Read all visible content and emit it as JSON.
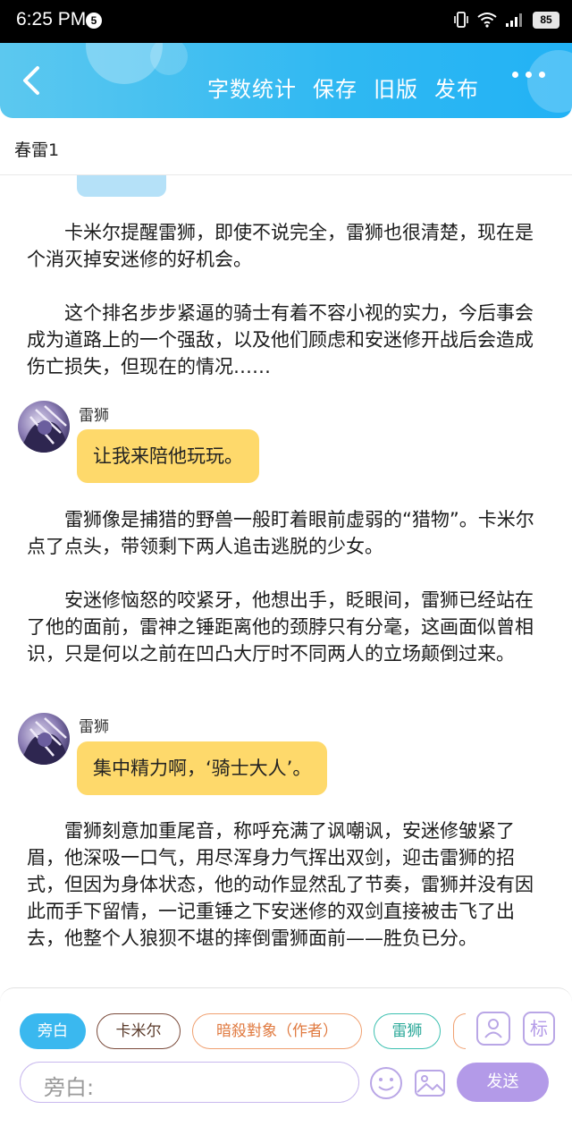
{
  "status_bar": {
    "time": "6:25 PM",
    "notification_badge": "5",
    "battery": "85"
  },
  "header": {
    "actions": [
      "字数统计",
      "保存",
      "旧版",
      "发布"
    ]
  },
  "chapter": {
    "title": "春雷1"
  },
  "content": {
    "paragraphs": [
      "卡米尔提醒雷狮，即使不说完全，雷狮也很清楚，现在是个消灭掉安迷修的好机会。",
      "这个排名步步紧逼的骑士有着不容小视的实力，今后事会成为道路上的一个强敌，以及他们顾虑和安迷修开战后会造成伤亡损失，但现在的情况……",
      "雷狮像是捕猎的野兽一般盯着眼前虚弱的“猎物”。卡米尔点了点头，带领剩下两人追击逃脱的少女。",
      "安迷修恼怒的咬紧牙，他想出手，眨眼间，雷狮已经站在了他的面前，雷神之锤距离他的颈脖只有分毫，这画面似曾相识，只是何以之前在凹凸大厅时不同两人的立场颠倒过来。",
      "雷狮刻意加重尾音，称呼充满了讽嘲讽，安迷修皱紧了眉，他深吸一口气，用尽浑身力气挥出双剑，迎击雷狮的招式，但因为身体状态，他的动作显然乱了节奏，雷狮并没有因此而手下留情，一记重锤之下安迷修的双剑直接被击飞了出去，他整个人狼狈不堪的摔倒雷狮面前——胜负已分。"
    ],
    "messages": [
      {
        "speaker": "雷狮",
        "text": "让我来陪他玩玩。"
      },
      {
        "speaker": "雷狮",
        "text": "集中精力啊，‘骑士大人’。"
      }
    ]
  },
  "bottom_panel": {
    "roles": [
      "旁白",
      "卡米尔",
      "暗殺對象（作者）",
      "雷狮"
    ],
    "active_role": "旁白",
    "role_colors": [
      "#3ab8ef",
      "#7a4a3a",
      "#f0a070",
      "#3cc0b0"
    ],
    "tag_button": "标",
    "input_placeholder": "旁白:",
    "send_label": "发送"
  }
}
